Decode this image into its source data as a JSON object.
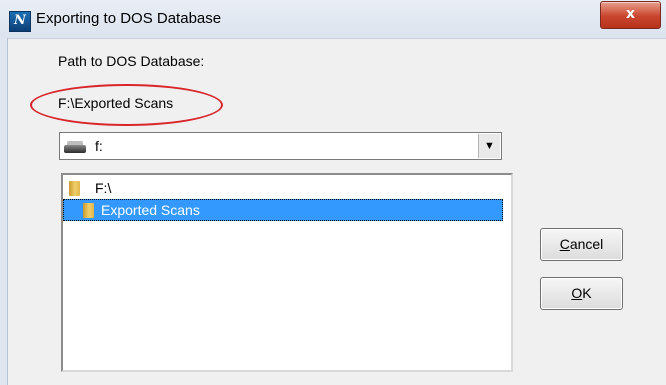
{
  "window": {
    "title": "Exporting to DOS Database",
    "app_icon_glyph": "N",
    "close_glyph": "x"
  },
  "path": {
    "label": "Path to DOS Database:",
    "value": "F:\\Exported Scans"
  },
  "drive": {
    "selected": "f:",
    "icon": "drive-icon"
  },
  "directories": [
    {
      "label": "F:\\",
      "selected": false,
      "icon": "open-folder-icon"
    },
    {
      "label": "Exported Scans",
      "selected": true,
      "icon": "open-folder-icon"
    }
  ],
  "buttons": {
    "cancel": {
      "label": "Cancel",
      "mnemonic": "C",
      "rest": "ancel"
    },
    "ok": {
      "label": "OK",
      "mnemonic": "O",
      "rest": "K"
    }
  },
  "colors": {
    "selection": "#3399ff",
    "annotation_ellipse": "#d8262b",
    "close_button": "#c9452d"
  }
}
